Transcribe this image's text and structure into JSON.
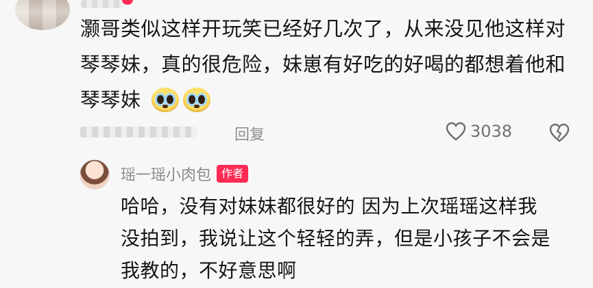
{
  "comment": {
    "text_lines": [
      "灏哥类似这样开玩笑已经好几次了，从来没见他这样对",
      "琴琴妹，真的很危险，妹崽有好吃的好喝的都想着他和",
      "琴琴妹"
    ],
    "emojis": [
      "crying-face-emoji",
      "crying-face-emoji"
    ],
    "reply_label": "回复",
    "like_count": "3038"
  },
  "reply": {
    "author_name": "瑶一瑶小肉包",
    "author_badge": "作者",
    "text_lines": [
      "哈哈，没有对妹妹都很好的 因为上次瑶瑶这样我",
      "没拍到，我说让这个轻轻的弄，但是小孩子不会是",
      "我教的，不好意思啊"
    ]
  },
  "colors": {
    "badge_red": "#fe2c55",
    "muted_text": "#8d8d8d",
    "background": "#f7f7f7"
  }
}
